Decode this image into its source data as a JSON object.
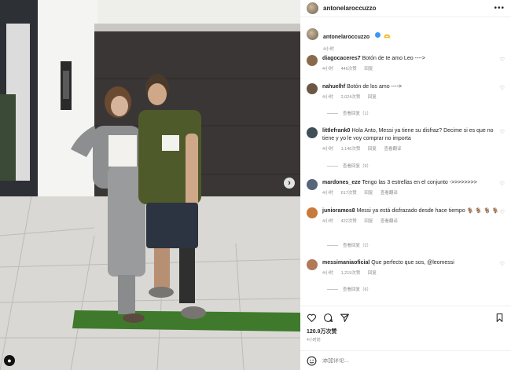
{
  "post": {
    "username": "antonelaroccuzzo",
    "more_icon": "more-horizontal-icon"
  },
  "caption": {
    "username": "antonelaroccuzzo",
    "emoji": "🫶",
    "time": "4小时"
  },
  "comments": [
    {
      "username": "diagocaceres7",
      "text": "Botón de te amo Leo ---->",
      "time": "4小时",
      "likes": "446次赞",
      "reply": "回复",
      "translate": "",
      "replies": "",
      "avatar_color": "#8a6a4c"
    },
    {
      "username": "nahuelhf",
      "text": "Botón de los amo ---->",
      "time": "4小时",
      "likes": "2,024次赞",
      "reply": "回复",
      "translate": "",
      "replies": "查看回复（1）",
      "avatar_color": "#6b5844"
    },
    {
      "username": "littlefrank0",
      "text": "Hola Anto, Messi ya tiene su disfraz? Decime si es que no tiene y yo le voy comprar no importa",
      "time": "4小时",
      "likes": "1,146次赞",
      "reply": "回复",
      "translate": "查看翻译",
      "replies": "查看回复（9）",
      "avatar_color": "#3f4f56"
    },
    {
      "username": "mardones_eze",
      "text": "Tengo las 3 estrellas en el conjunto ->>>>>>>>",
      "time": "4小时",
      "likes": "617次赞",
      "reply": "回复",
      "translate": "查看翻译",
      "replies": "",
      "avatar_color": "#58647a"
    },
    {
      "username": "junioramos8",
      "text": "Messi ya está disfrazado desde hace tiempo 🐐 🐐 🐐 🐐",
      "time": "4小时",
      "likes": "422次赞",
      "reply": "回复",
      "translate": "查看翻译",
      "replies": "查看回复（2）",
      "avatar_color": "#c77a3a"
    },
    {
      "username": "messimaniaoficial",
      "text": "Que perfecto que sos, @leomessi",
      "time": "4小时",
      "likes": "1,219次赞",
      "reply": "回复",
      "translate": "",
      "replies": "查看回复（6）",
      "avatar_color": "#b07a5a"
    }
  ],
  "actions": {
    "like_icon": "heart-icon",
    "comment_icon": "comment-icon",
    "share_icon": "send-icon",
    "save_icon": "bookmark-icon"
  },
  "likes_count": "120.9万次赞",
  "posted_ago": "4小时前",
  "add_comment": {
    "placeholder": "添加评论...",
    "emoji_icon": "smiley-icon"
  }
}
